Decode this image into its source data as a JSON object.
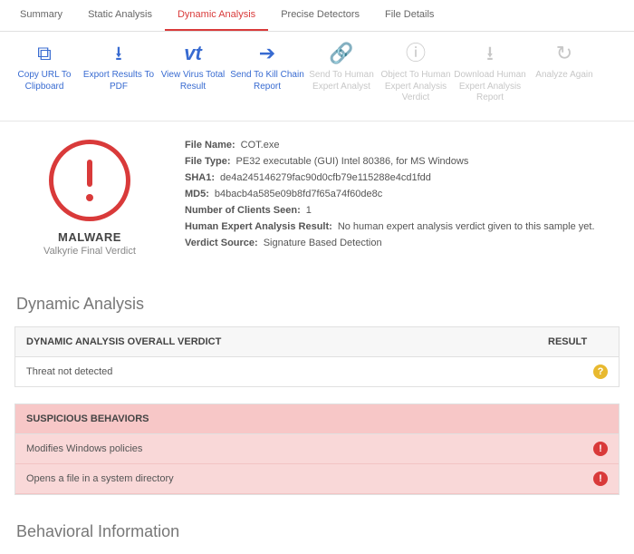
{
  "tabs": {
    "summary": "Summary",
    "static": "Static Analysis",
    "dynamic": "Dynamic Analysis",
    "precise": "Precise Detectors",
    "filedetails": "File Details"
  },
  "toolbar": {
    "copy": "Copy URL To Clipboard",
    "export": "Export Results To PDF",
    "vt": "View Virus Total Result",
    "kill": "Send To Kill Chain Report",
    "send_expert": "Send To Human Expert Analyst",
    "object_expert": "Object To Human Expert Analysis Verdict",
    "download_expert": "Download Human Expert Analysis Report",
    "analyze": "Analyze Again"
  },
  "verdict": {
    "label": "MALWARE",
    "sub": "Valkyrie Final Verdict"
  },
  "file": {
    "name_k": "File Name:",
    "name_v": "COT.exe",
    "type_k": "File Type:",
    "type_v": "PE32 executable (GUI) Intel 80386, for MS Windows",
    "sha1_k": "SHA1:",
    "sha1_v": "de4a245146279fac90d0cfb79e115288e4cd1fdd",
    "md5_k": "MD5:",
    "md5_v": "b4bacb4a585e09b8fd7f65a74f60de8c",
    "clients_k": "Number of Clients Seen:",
    "clients_v": "1",
    "hear_k": "Human Expert Analysis Result:",
    "hear_v": "No human expert analysis verdict given to this sample yet.",
    "src_k": "Verdict Source:",
    "src_v": "Signature Based Detection"
  },
  "dynamic": {
    "title": "Dynamic Analysis",
    "verdict_header": "DYNAMIC ANALYSIS OVERALL VERDICT",
    "result_header": "RESULT",
    "row1": "Threat not detected",
    "susp_header": "SUSPICIOUS BEHAVIORS",
    "susp1": "Modifies Windows policies",
    "susp2": "Opens a file in a system directory"
  },
  "behavioral": {
    "title": "Behavioral Information"
  }
}
